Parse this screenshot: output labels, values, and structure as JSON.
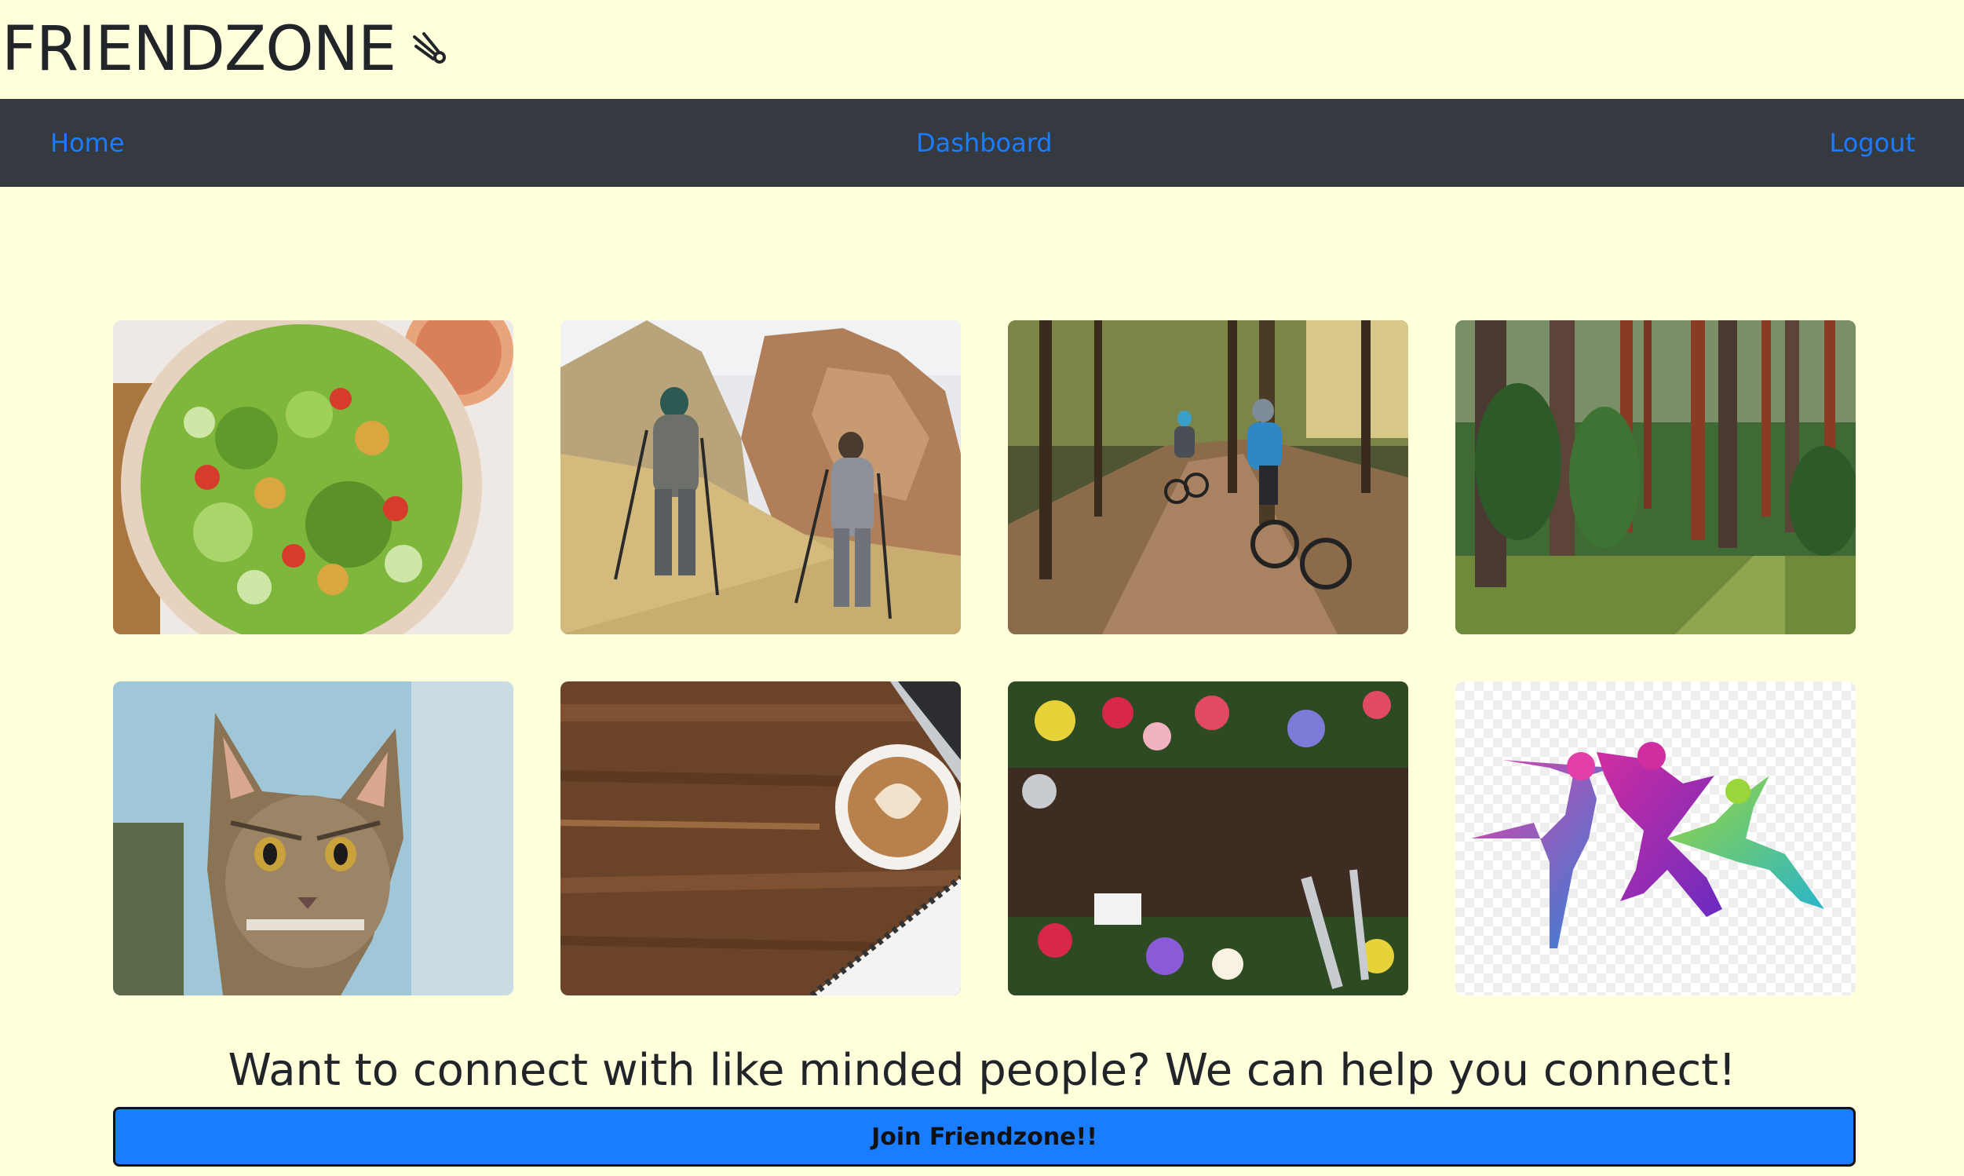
{
  "brand": {
    "title": "FRIENDZONE",
    "icon": "meteor-icon"
  },
  "nav": {
    "home": "Home",
    "dashboard": "Dashboard",
    "logout": "Logout"
  },
  "gallery": {
    "images": [
      {
        "subject": "salad bowl"
      },
      {
        "subject": "two hikers on a rocky hillside"
      },
      {
        "subject": "cyclists on a forest trail"
      },
      {
        "subject": "tall trees in a green forest"
      },
      {
        "subject": "tabby cat"
      },
      {
        "subject": "wooden desk with latte art coffee"
      },
      {
        "subject": "garden soil with flowers and tools"
      },
      {
        "subject": "colorful dancer silhouettes"
      }
    ]
  },
  "cta": {
    "tagline": "Want to connect with like minded people? We can help you connect!",
    "button": "Join Friendzone!!"
  },
  "colors": {
    "background": "#ffffdc",
    "navbar": "#343a40",
    "link": "#1a7cff",
    "button": "#1a7cff"
  }
}
